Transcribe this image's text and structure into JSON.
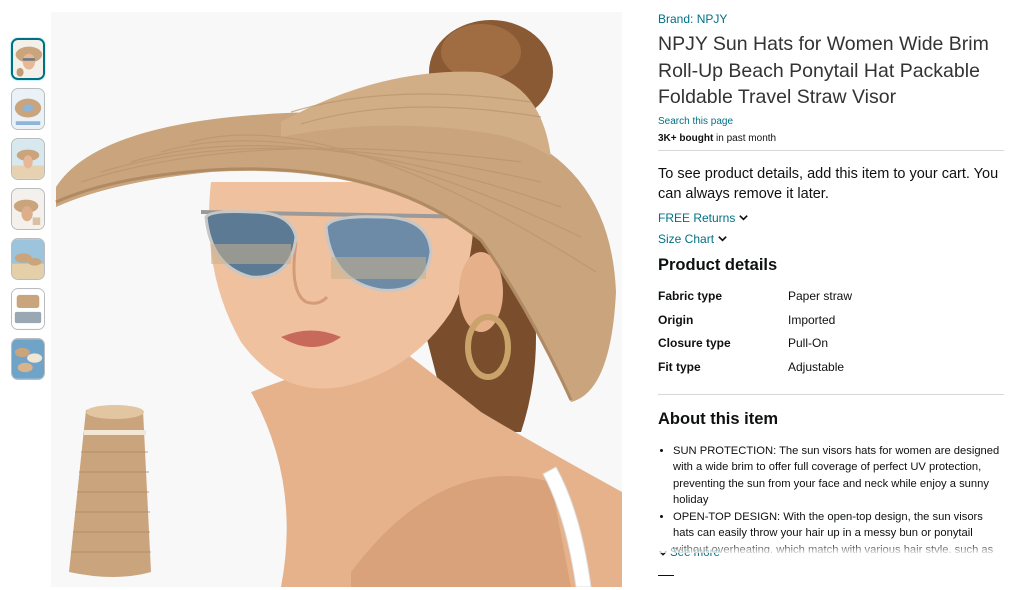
{
  "gallery": {
    "thumbnail_count": 7,
    "active_index": 0,
    "share_icon": "share-icon"
  },
  "product": {
    "brand": "Brand: NPJY",
    "title": "NPJY Sun Hats for Women Wide Brim Roll-Up Beach Ponytail Hat Packable Foldable Travel Straw Visor",
    "search_link": "Search this page",
    "bought_bold": "3K+ bought",
    "bought_rest": " in past month"
  },
  "cart_note": "To see product details, add this item to your cart. You can always remove it later.",
  "links": {
    "free_returns": "FREE Returns",
    "size_chart": "Size Chart"
  },
  "product_details": {
    "heading": "Product details",
    "rows": [
      {
        "key": "Fabric type",
        "value": "Paper straw"
      },
      {
        "key": "Origin",
        "value": "Imported"
      },
      {
        "key": "Closure type",
        "value": "Pull-On"
      },
      {
        "key": "Fit type",
        "value": "Adjustable"
      }
    ]
  },
  "about": {
    "heading": "About this item",
    "bullets": [
      "SUN PROTECTION: The sun visors hats for women are designed with a wide brim to offer full coverage of perfect UV protection, preventing the sun from your face and neck while enjoy a sunny holiday",
      "OPEN-TOP DESIGN: With the open-top design, the sun visors hats can easily throw your hair up in a messy bun or ponytail without overheating, which match with various hair style, such as pulls or other daily hairstyles"
    ],
    "see_more": "See more"
  },
  "colors": {
    "link": "#007185",
    "text": "#0f1111",
    "title": "#333333",
    "divider": "#d5d9d9",
    "straw": "#c9a47c"
  }
}
